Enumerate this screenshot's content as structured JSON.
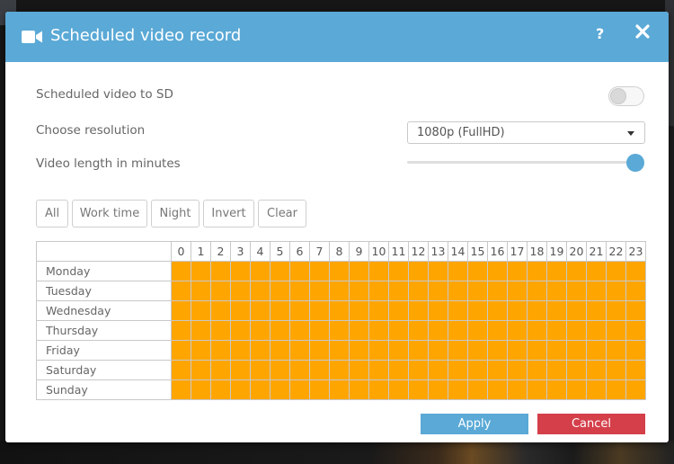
{
  "dialog": {
    "title": "Scheduled video record",
    "help_label": "?",
    "accent_color": "#5aa9d6",
    "cancel_color": "#d43f4a",
    "schedule_color": "#ffa500"
  },
  "settings": {
    "sd_label": "Scheduled video to SD",
    "sd_enabled": false,
    "resolution_label": "Choose resolution",
    "resolution_value": "1080p (FullHD)",
    "length_label": "Video length in minutes",
    "length_slider_fraction": 1.0
  },
  "quick_buttons": [
    {
      "label": "All"
    },
    {
      "label": "Work time"
    },
    {
      "label": "Night"
    },
    {
      "label": "Invert"
    },
    {
      "label": "Clear"
    }
  ],
  "schedule": {
    "hours": [
      "0",
      "1",
      "2",
      "3",
      "4",
      "5",
      "6",
      "7",
      "8",
      "9",
      "10",
      "11",
      "12",
      "13",
      "14",
      "15",
      "16",
      "17",
      "18",
      "19",
      "20",
      "21",
      "22",
      "23"
    ],
    "days": [
      "Monday",
      "Tuesday",
      "Wednesday",
      "Thursday",
      "Friday",
      "Saturday",
      "Sunday"
    ],
    "all_selected": true
  },
  "footer": {
    "apply_label": "Apply",
    "cancel_label": "Cancel"
  },
  "icons": {
    "title_icon": "video-camera-icon",
    "help_icon": "question-mark-icon",
    "close_icon": "close-icon",
    "select_icon": "caret-down-icon"
  }
}
